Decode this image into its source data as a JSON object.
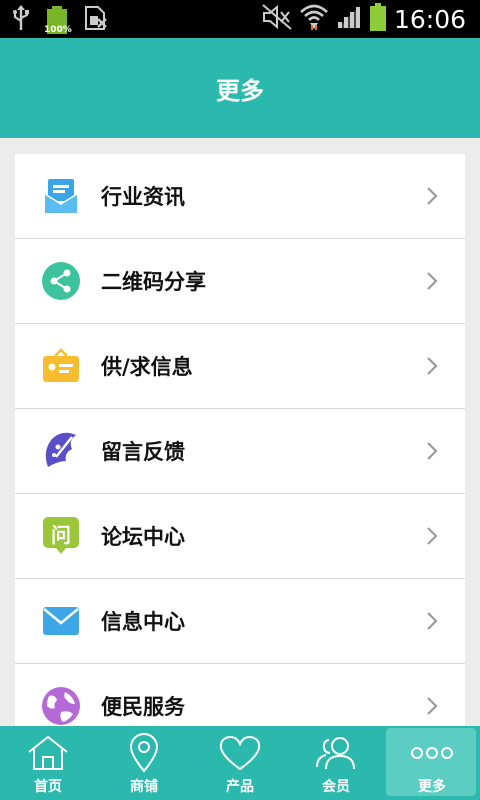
{
  "status_bar": {
    "battery_percent": "100%",
    "time": "16:06"
  },
  "header": {
    "title": "更多"
  },
  "menu": {
    "items": [
      {
        "label": "行业资讯",
        "icon": "news-icon",
        "color": "#3aa6e8"
      },
      {
        "label": "二维码分享",
        "icon": "share-icon",
        "color": "#3cc39c"
      },
      {
        "label": "供/求信息",
        "icon": "supply-demand-icon",
        "color": "#f7bd2e"
      },
      {
        "label": "留言反馈",
        "icon": "feedback-icon",
        "color": "#5b4fc9"
      },
      {
        "label": "论坛中心",
        "icon": "forum-icon",
        "color": "#9bc63a",
        "glyph": "问"
      },
      {
        "label": "信息中心",
        "icon": "mail-icon",
        "color": "#3da6e6"
      },
      {
        "label": "便民服务",
        "icon": "globe-icon",
        "color": "#b569d6"
      }
    ]
  },
  "tabs": [
    {
      "label": "首页",
      "icon": "home-icon"
    },
    {
      "label": "商铺",
      "icon": "location-pin-icon"
    },
    {
      "label": "产品",
      "icon": "heart-icon"
    },
    {
      "label": "会员",
      "icon": "members-icon"
    },
    {
      "label": "更多",
      "icon": "more-dots-icon",
      "active": true
    }
  ],
  "colors": {
    "accent": "#2cb9ad",
    "accent_active": "#5ccdc3",
    "background": "#ececec"
  }
}
